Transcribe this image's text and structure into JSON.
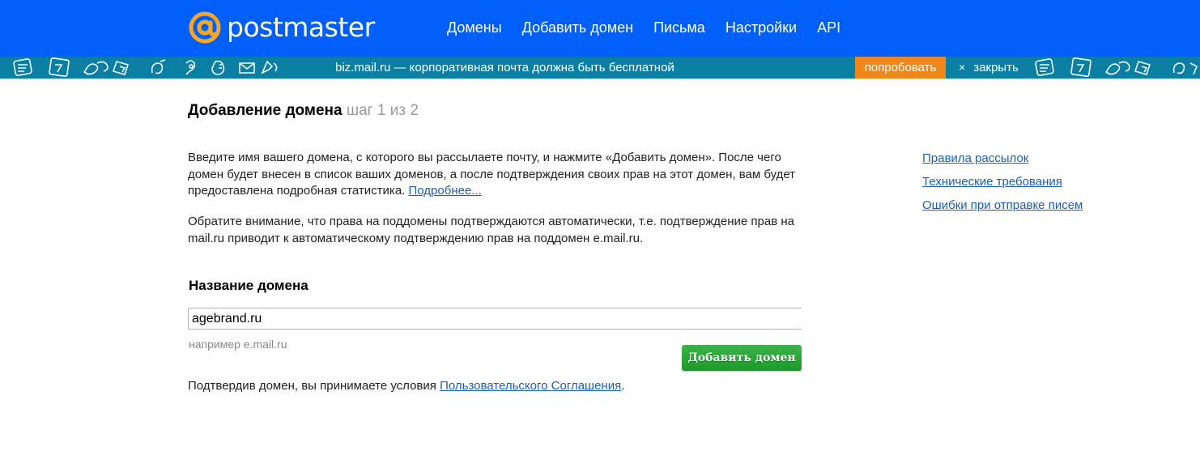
{
  "header": {
    "logo_text": "postmaster",
    "nav": [
      "Домены",
      "Добавить домен",
      "Письма",
      "Настройки",
      "API"
    ]
  },
  "promo": {
    "text": "biz.mail.ru — корпоративная почта должна быть бесплатной",
    "try_label": "попробовать",
    "close_symbol": "×",
    "close_label": "закрыть"
  },
  "page": {
    "title": "Добавление домена",
    "step": "шаг 1 из 2",
    "intro_text": "Введите имя вашего домена, с которого вы рассылаете почту, и нажмите «Добавить домен». После чего домен будет внесен в список ваших доменов, а после подтверждения своих прав на этот домен, вам будет предоставлена подробная статистика.",
    "more_link": "Подробнее...",
    "note_text": "Обратите внимание, что права на поддомены подтверждаются автоматически, т.е. подтверждение прав на mail.ru приводит к автоматическому подтверждению прав на поддомен e.mail.ru."
  },
  "sidebar": {
    "links": [
      "Правила рассылок",
      "Технические требования",
      "Ошибки при отправке писем"
    ]
  },
  "form": {
    "label": "Название домена",
    "value": "agebrand.ru",
    "hint": "например e.mail.ru",
    "submit_label": "Добавить домен",
    "agreement_prefix": "Подтвердив домен, вы принимаете условия",
    "agreement_link": "Пользовательского Соглашения",
    "agreement_suffix": "."
  },
  "colors": {
    "header_bg": "#005ff9",
    "promo_bg": "#0b7fa3",
    "try_button": "#f0871a",
    "submit_button": "#1a9a29",
    "link": "#1a5fb4",
    "logo_at": "#f5a623"
  }
}
